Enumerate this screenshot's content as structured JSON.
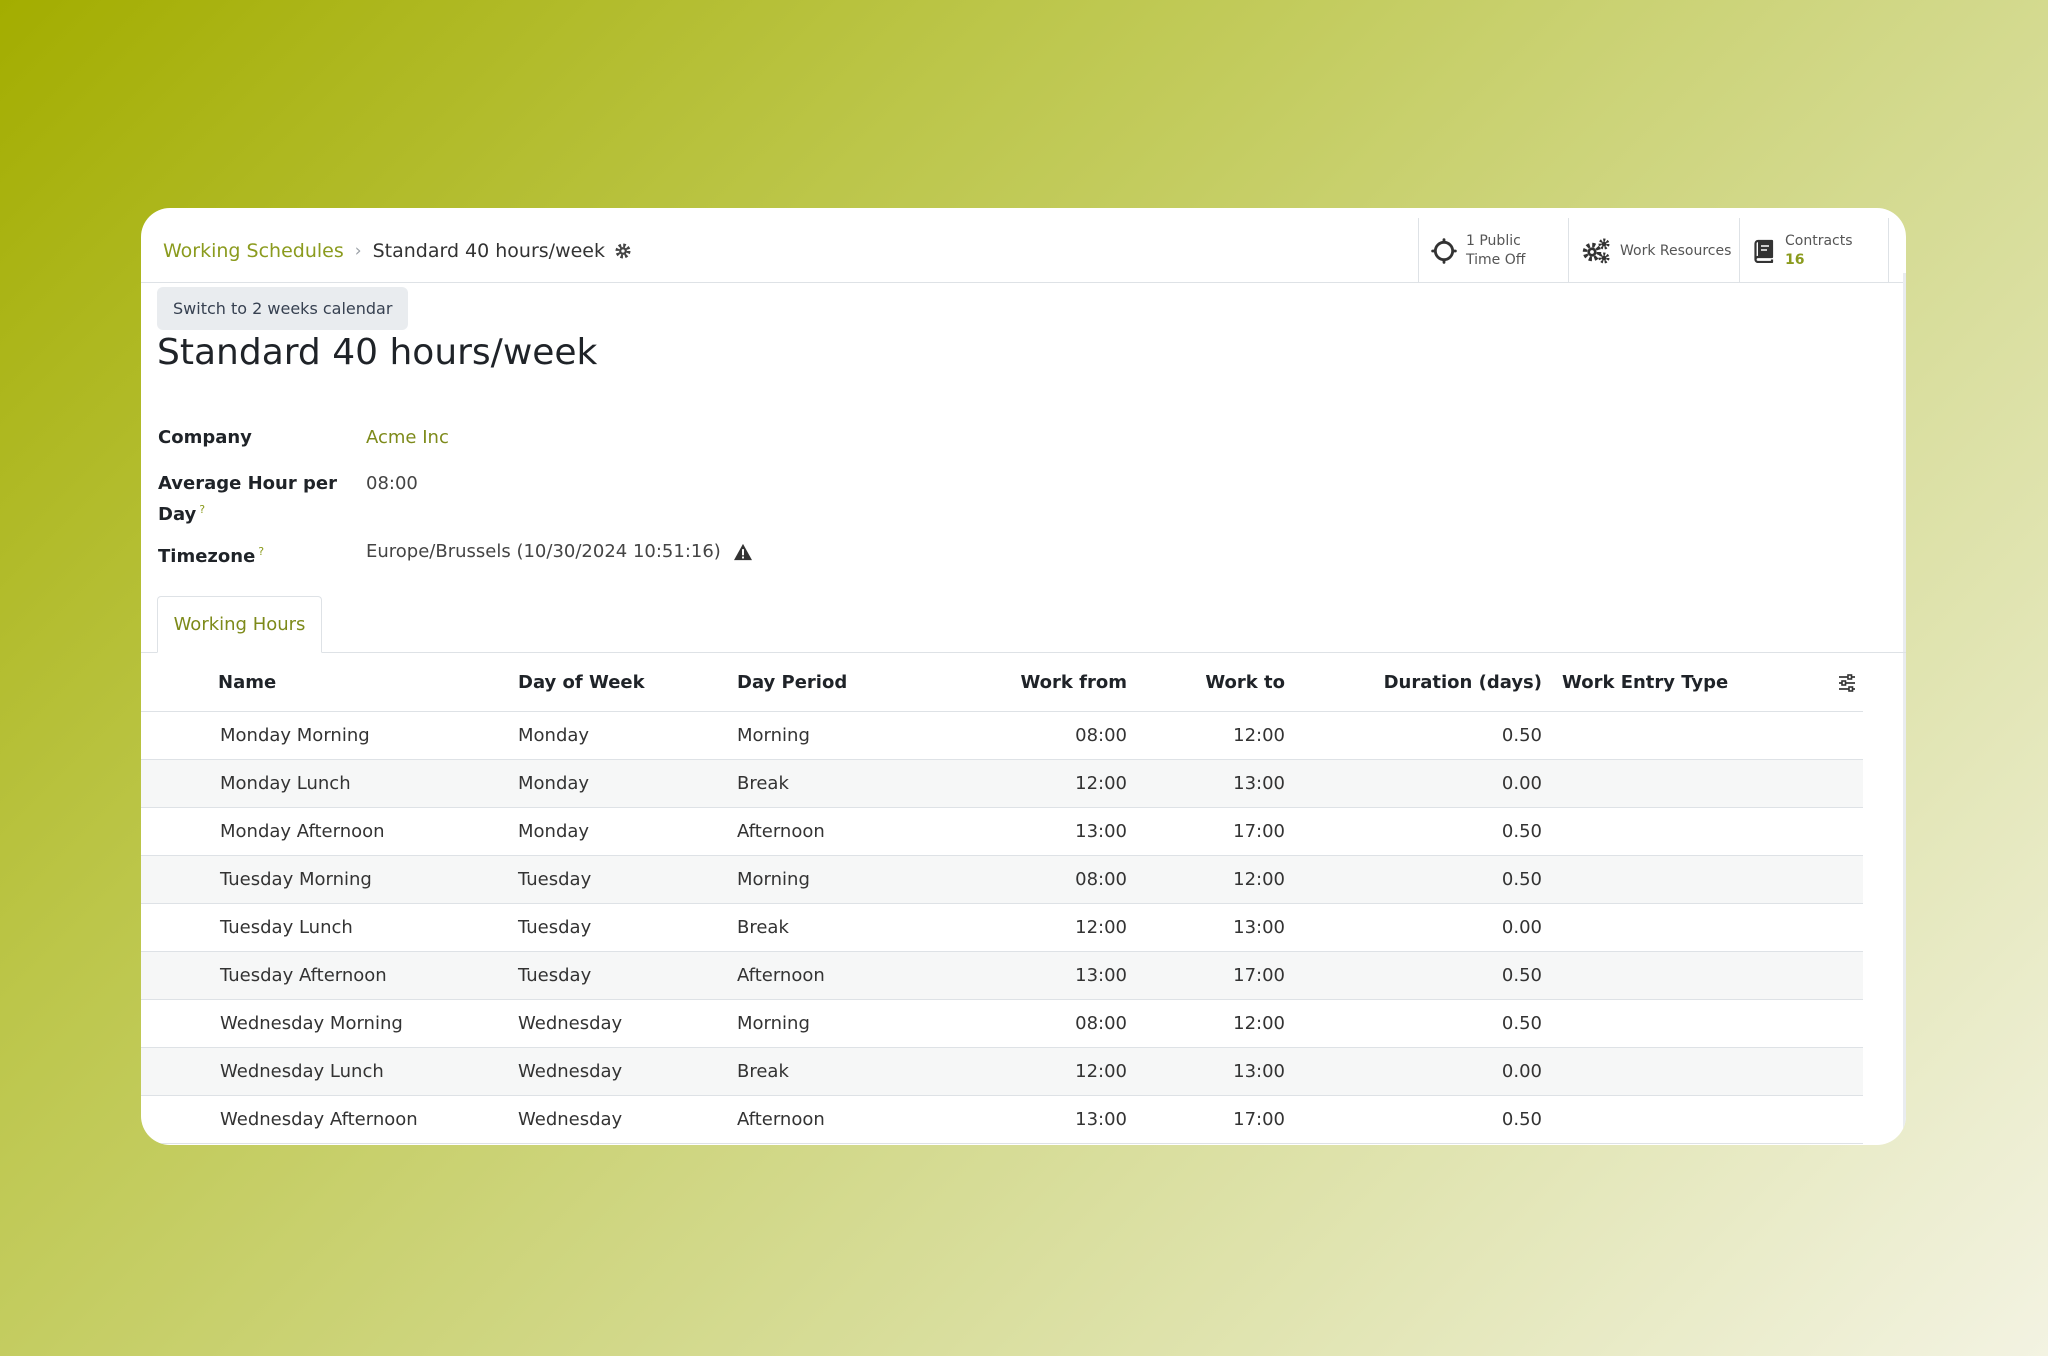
{
  "breadcrumb": {
    "parent": "Working Schedules",
    "separator": "›",
    "current": "Standard 40 hours/week"
  },
  "smart_buttons": {
    "public_time_off": {
      "line1": "1 Public",
      "line2": "Time Off"
    },
    "work_resources": {
      "label": "Work Resources"
    },
    "contracts": {
      "label": "Contracts",
      "count": "16"
    }
  },
  "switch_button": "Switch to 2 weeks calendar",
  "title": "Standard 40 hours/week",
  "fields": {
    "company": {
      "label": "Company",
      "value": "Acme Inc"
    },
    "avg_hours": {
      "label_line1": "Average Hour per",
      "label_line2": "Day",
      "help": "?",
      "value": "08:00"
    },
    "timezone": {
      "label": "Timezone",
      "help": "?",
      "value": "Europe/Brussels (10/30/2024 10:51:16)"
    }
  },
  "tabs": {
    "working_hours": "Working Hours"
  },
  "table": {
    "headers": [
      "Name",
      "Day of Week",
      "Day Period",
      "Work from",
      "Work to",
      "Duration (days)",
      "Work Entry Type"
    ],
    "rows": [
      [
        "Monday Morning",
        "Monday",
        "Morning",
        "08:00",
        "12:00",
        "0.50",
        ""
      ],
      [
        "Monday Lunch",
        "Monday",
        "Break",
        "12:00",
        "13:00",
        "0.00",
        ""
      ],
      [
        "Monday Afternoon",
        "Monday",
        "Afternoon",
        "13:00",
        "17:00",
        "0.50",
        ""
      ],
      [
        "Tuesday Morning",
        "Tuesday",
        "Morning",
        "08:00",
        "12:00",
        "0.50",
        ""
      ],
      [
        "Tuesday Lunch",
        "Tuesday",
        "Break",
        "12:00",
        "13:00",
        "0.00",
        ""
      ],
      [
        "Tuesday Afternoon",
        "Tuesday",
        "Afternoon",
        "13:00",
        "17:00",
        "0.50",
        ""
      ],
      [
        "Wednesday Morning",
        "Wednesday",
        "Morning",
        "08:00",
        "12:00",
        "0.50",
        ""
      ],
      [
        "Wednesday Lunch",
        "Wednesday",
        "Break",
        "12:00",
        "13:00",
        "0.00",
        ""
      ],
      [
        "Wednesday Afternoon",
        "Wednesday",
        "Afternoon",
        "13:00",
        "17:00",
        "0.50",
        ""
      ]
    ]
  },
  "icons": {
    "breadcrumb_settings": "gear-icon",
    "public_time_off": "sun-icon",
    "work_resources": "gears-icon",
    "contracts": "book-icon",
    "timezone_warning": "warning-icon",
    "optional_columns": "sliders-icon"
  },
  "colors": {
    "accent": "#8b9b1e",
    "link": "#7d8a1a",
    "text": "#1f2328",
    "row_stripe": "#f6f7f7",
    "border": "#dee2e6"
  }
}
